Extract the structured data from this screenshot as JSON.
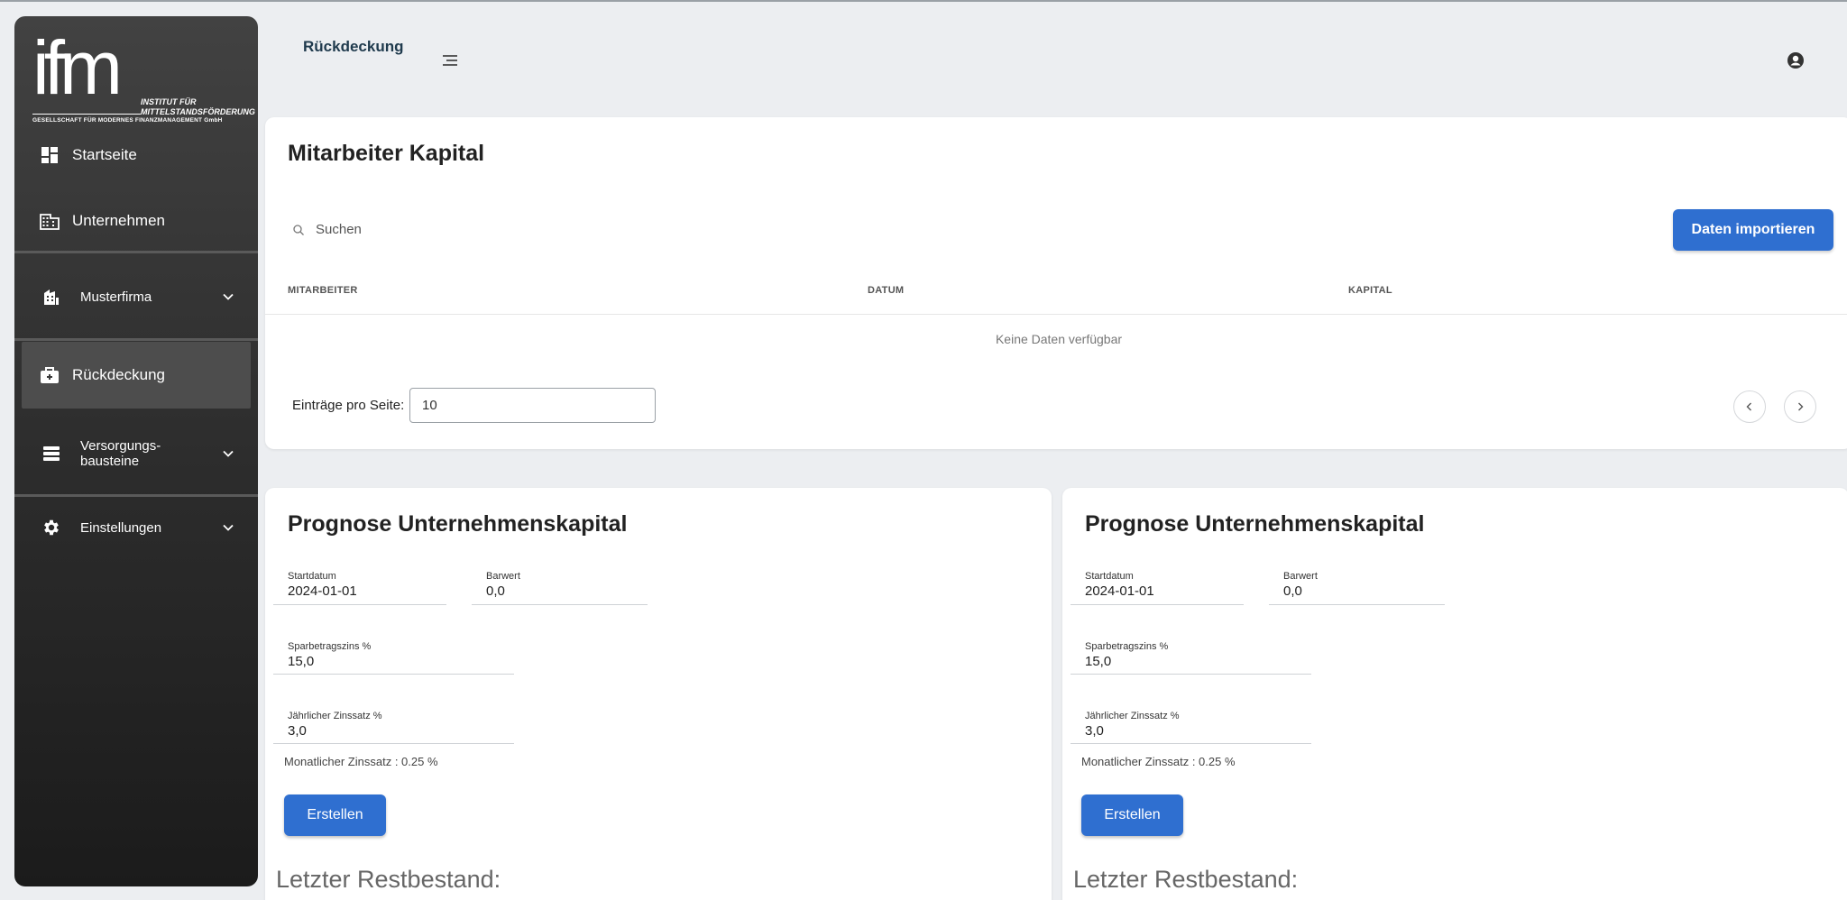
{
  "sidebar": {
    "logo": {
      "mark": "ifm",
      "institute": "INSTITUT FÜR MITTELSTANDSFÖRDERUNG",
      "subtitle": "GESELLSCHAFT FÜR MODERNES FINANZMANAGEMENT GmbH"
    },
    "items": [
      {
        "label": "Startseite",
        "icon": "dashboard-icon"
      },
      {
        "label": "Unternehmen",
        "icon": "building-icon"
      },
      {
        "label": "Musterfirma",
        "icon": "company-icon",
        "expandable": true
      },
      {
        "label": "Rückdeckung",
        "icon": "briefcase-icon",
        "active": true
      },
      {
        "label_line1": "Versorgungs-",
        "label_line2": "bausteine",
        "icon": "list-icon",
        "expandable": true
      },
      {
        "label": "Einstellungen",
        "icon": "gear-icon",
        "expandable": true
      }
    ]
  },
  "header": {
    "title": "Rückdeckung"
  },
  "colors": {
    "accent": "#2f6fd0",
    "sidebar_dark": "#2f2f2f",
    "background": "#eceef1"
  },
  "employee_capital": {
    "title": "Mitarbeiter Kapital",
    "search_placeholder": "Suchen",
    "import_label": "Daten importieren",
    "columns": [
      "MITARBEITER",
      "DATUM",
      "KAPITAL"
    ],
    "empty_text": "Keine Daten verfügbar",
    "per_page_label": "Einträge pro Seite:",
    "per_page_value": "10"
  },
  "forecasts": [
    {
      "title": "Prognose Unternehmenskapital",
      "start_label": "Startdatum",
      "start_value": "2024-01-01",
      "present_label": "Barwert",
      "present_value": "0,0",
      "savings_label": "Sparbetragszins %",
      "savings_value": "15,0",
      "annual_label": "Jährlicher Zinssatz %",
      "annual_value": "3,0",
      "monthly_hint": "Monatlicher Zinssatz : 0.25 %",
      "create_label": "Erstellen",
      "rest_label": "Letzter Restbestand:"
    },
    {
      "title": "Prognose Unternehmenskapital",
      "start_label": "Startdatum",
      "start_value": "2024-01-01",
      "present_label": "Barwert",
      "present_value": "0,0",
      "savings_label": "Sparbetragszins %",
      "savings_value": "15,0",
      "annual_label": "Jährlicher Zinssatz %",
      "annual_value": "3,0",
      "monthly_hint": "Monatlicher Zinssatz : 0.25 %",
      "create_label": "Erstellen",
      "rest_label": "Letzter Restbestand:"
    }
  ]
}
